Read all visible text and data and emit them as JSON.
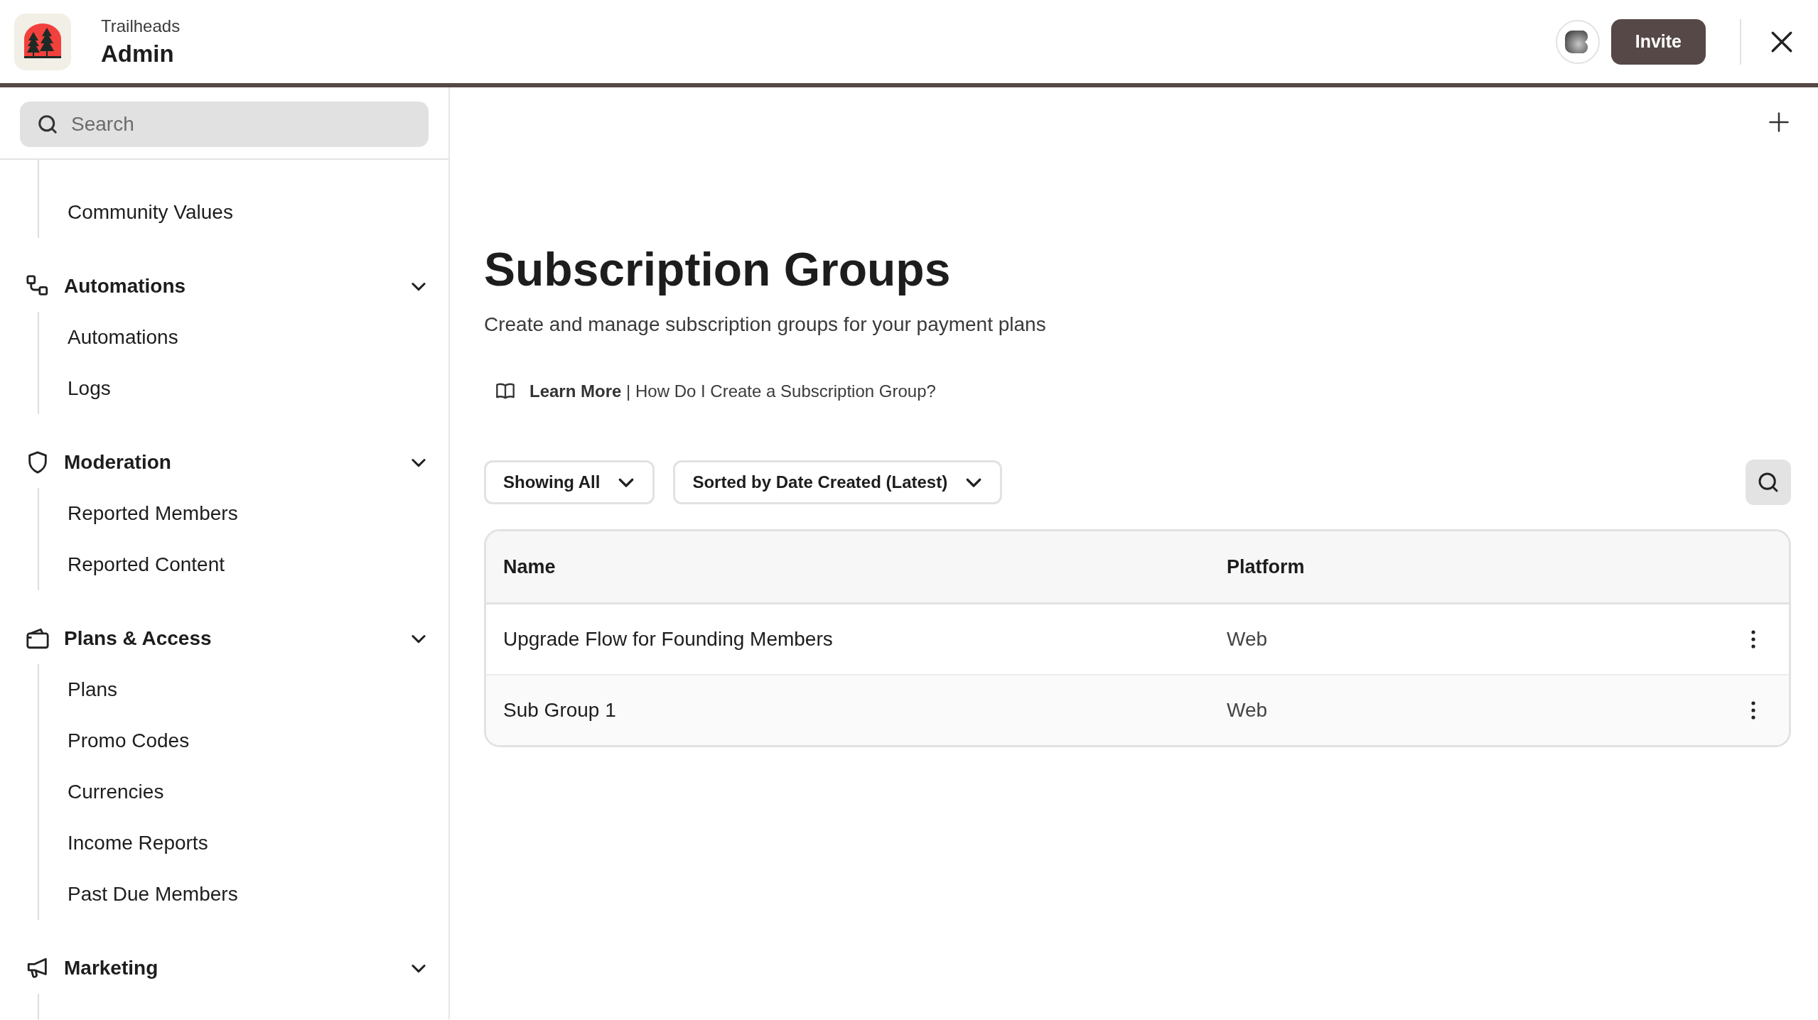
{
  "header": {
    "org": "Trailheads",
    "title": "Admin",
    "invite_button": "Invite"
  },
  "sidebar": {
    "search": {
      "placeholder": "Search"
    },
    "groups": [
      {
        "items": [
          {
            "label": "Community Values"
          }
        ]
      },
      {
        "label": "Automations",
        "expanded": true,
        "items": [
          {
            "label": "Automations"
          },
          {
            "label": "Logs"
          }
        ]
      },
      {
        "label": "Moderation",
        "expanded": true,
        "items": [
          {
            "label": "Reported Members"
          },
          {
            "label": "Reported Content"
          }
        ]
      },
      {
        "label": "Plans & Access",
        "expanded": true,
        "items": [
          {
            "label": "Plans"
          },
          {
            "label": "Promo Codes"
          },
          {
            "label": "Currencies"
          },
          {
            "label": "Income Reports"
          },
          {
            "label": "Past Due Members"
          }
        ]
      },
      {
        "label": "Marketing",
        "expanded": true
      }
    ]
  },
  "main": {
    "title": "Subscription Groups",
    "subtitle": "Create and manage subscription groups for your payment plans",
    "learn_more": {
      "label": "Learn More",
      "separator": "|",
      "link": "How Do I Create a Subscription Group?"
    },
    "filters": [
      {
        "label": "Showing All"
      },
      {
        "label": "Sorted by Date Created (Latest)"
      }
    ],
    "table": {
      "columns": [
        "Name",
        "Platform"
      ],
      "rows": [
        {
          "name": "Upgrade Flow for Founding Members",
          "platform": "Web"
        },
        {
          "name": "Sub Group 1",
          "platform": "Web"
        }
      ]
    }
  }
}
